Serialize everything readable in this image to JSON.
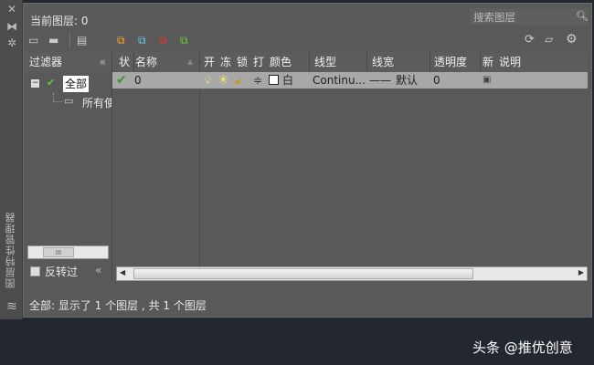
{
  "side_title": "图层特性管理器",
  "current_layer": "当前图层: 0",
  "search_placeholder": "搜索图层",
  "filters": {
    "title": "过滤器",
    "collapse": "«",
    "root": "全部",
    "child": "所有使",
    "invert": "反转过"
  },
  "columns": [
    "状",
    "名称",
    "开",
    "冻",
    "锁",
    "打",
    "颜色",
    "线型",
    "线宽",
    "透明度",
    "新",
    "说明"
  ],
  "layers": [
    {
      "status": "current",
      "name": "0",
      "color_name": "白",
      "color": "#ffffff",
      "linetype": "Continu...",
      "lineweight_line": "——",
      "lineweight": "默认",
      "transparency": "0"
    }
  ],
  "status_text": "全部: 显示了 1 个图层 , 共 1 个图层",
  "watermark": "头条 @推优创意"
}
